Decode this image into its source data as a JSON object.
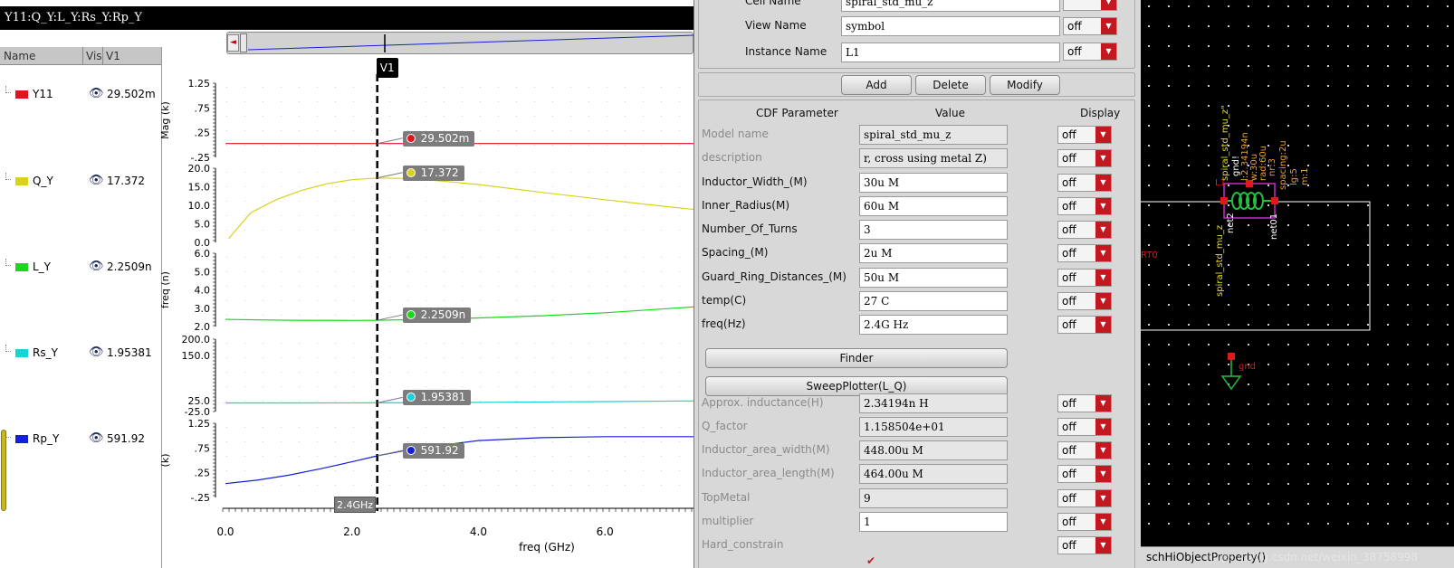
{
  "viewer": {
    "title": "Y11:Q_Y:L_Y:Rs_Y:Rp_Y",
    "columns": {
      "name": "Name",
      "vis": "Vis",
      "v1": "V1"
    },
    "signals": [
      {
        "name": "Y11",
        "value": "29.502m",
        "color": "#e0141c"
      },
      {
        "name": "Q_Y",
        "value": "17.372",
        "color": "#d8d21c"
      },
      {
        "name": "L_Y",
        "value": "2.2509n",
        "color": "#1cd81c"
      },
      {
        "name": "Rs_Y",
        "value": "1.95381",
        "color": "#1cd2d8"
      },
      {
        "name": "Rp_Y",
        "value": "591.92",
        "color": "#1420d8"
      }
    ],
    "eye_glyph": "👁",
    "vertical_marker": "V1",
    "cursor_x_label": "2.4GHz"
  },
  "chart_data": {
    "type": "line",
    "xlabel": "freq (GHz)",
    "x_ticks": [
      "0.0",
      "2.0",
      "4.0",
      "6.0"
    ],
    "xlim": [
      0,
      7.4
    ],
    "marker_x": 2.4,
    "strips": [
      {
        "name": "Y11",
        "ylabel": "Mag (k)",
        "yticks": [
          "1.25",
          ".75",
          ".25",
          "-.25"
        ],
        "ylim": [
          -0.25,
          1.25
        ],
        "series": {
          "name": "Y11",
          "x": [
            0,
            7.4
          ],
          "y": [
            0.0295,
            0.0295
          ]
        },
        "marker": {
          "x": 2.4,
          "label": "29.502m"
        }
      },
      {
        "name": "Q_Y",
        "ylabel": "",
        "yticks": [
          "20.0",
          "15.0",
          "10.0",
          "5.0",
          "0.0"
        ],
        "ylim": [
          0,
          20
        ],
        "series": {
          "name": "Q_Y",
          "x": [
            0.05,
            0.4,
            0.8,
            1.2,
            1.6,
            2.0,
            2.4,
            3.0,
            4.0,
            5.0,
            6.0,
            7.0,
            7.4
          ],
          "y": [
            1.0,
            8.0,
            11.5,
            14.0,
            15.8,
            16.9,
            17.372,
            17.2,
            15.6,
            13.5,
            11.5,
            9.6,
            8.9
          ]
        },
        "marker": {
          "x": 2.4,
          "label": "17.372"
        }
      },
      {
        "name": "L_Y",
        "ylabel": "freq (n)",
        "yticks": [
          "6.0",
          "5.0",
          "4.0",
          "3.0",
          "2.0"
        ],
        "ylim": [
          1.9,
          6.0
        ],
        "series": {
          "name": "L_Y",
          "x": [
            0,
            1.0,
            2.0,
            2.4,
            3.0,
            4.0,
            5.0,
            6.0,
            7.0,
            7.4
          ],
          "y": [
            2.3,
            2.25,
            2.24,
            2.2509,
            2.29,
            2.38,
            2.5,
            2.67,
            2.9,
            3.0
          ]
        },
        "marker": {
          "x": 2.4,
          "label": "2.2509n"
        }
      },
      {
        "name": "Rs_Y",
        "ylabel": "",
        "yticks": [
          "200.0",
          "150.0",
          "25.0",
          "-25.0"
        ],
        "ylim": [
          -25,
          200
        ],
        "series": {
          "name": "Rs_Y",
          "x": [
            0,
            1.0,
            2.4,
            4.0,
            6.0,
            7.4
          ],
          "y": [
            1.8,
            1.85,
            1.95381,
            3.5,
            6.0,
            8.0
          ]
        },
        "marker": {
          "x": 2.4,
          "label": "1.95381"
        }
      },
      {
        "name": "Rp_Y",
        "ylabel": "(k)",
        "yticks": [
          "1.25",
          ".75",
          ".25",
          "-.25"
        ],
        "ylim": [
          -0.25,
          1.25
        ],
        "series": {
          "name": "Rp_Y",
          "x": [
            0,
            0.5,
            1.0,
            1.5,
            2.0,
            2.4,
            3.0,
            4.0,
            5.0,
            6.0,
            7.0,
            7.4
          ],
          "y": [
            0.03,
            0.1,
            0.2,
            0.33,
            0.47,
            0.592,
            0.74,
            0.9,
            0.96,
            0.98,
            0.98,
            0.98
          ]
        },
        "marker": {
          "x": 2.4,
          "label": "591.92"
        }
      }
    ]
  },
  "dialog": {
    "top_fields": [
      {
        "label": "Cell Name",
        "value": "spiral_std_mu_z",
        "display": ""
      },
      {
        "label": "View Name",
        "value": "symbol",
        "display": "off"
      },
      {
        "label": "Instance Name",
        "value": "L1",
        "display": "off"
      }
    ],
    "buttons": {
      "add": "Add",
      "delete": "Delete",
      "modify": "Modify"
    },
    "headers": {
      "param": "CDF Parameter",
      "value": "Value",
      "display": "Display"
    },
    "params": [
      {
        "label": "Model name",
        "value": "spiral_std_mu_z",
        "display": "off",
        "readonly": true
      },
      {
        "label": "description",
        "value": "r, cross using metal Z)",
        "display": "off",
        "readonly": true
      },
      {
        "label": "Inductor_Width_(M)",
        "value": "30u M",
        "display": "off",
        "readonly": false
      },
      {
        "label": "Inner_Radius(M)",
        "value": "60u M",
        "display": "off",
        "readonly": false
      },
      {
        "label": "Number_Of_Turns",
        "value": "3",
        "display": "off",
        "readonly": false
      },
      {
        "label": "Spacing_(M)",
        "value": "2u M",
        "display": "off",
        "readonly": false
      },
      {
        "label": "Guard_Ring_Distances_(M)",
        "value": "50u M",
        "display": "off",
        "readonly": false
      },
      {
        "label": "temp(C)",
        "value": "27 C",
        "display": "off",
        "readonly": false
      },
      {
        "label": "freq(Hz)",
        "value": "2.4G Hz",
        "display": "off",
        "readonly": false
      }
    ],
    "finder_label": "Finder",
    "sweep_label": "SweepPlotter(L_Q)",
    "results": [
      {
        "label": "Approx. inductance(H)",
        "value": "2.34194n H",
        "display": "off"
      },
      {
        "label": "Q_factor",
        "value": "1.158504e+01",
        "display": "off"
      },
      {
        "label": "Inductor_area_width(M)",
        "value": "448.00u M",
        "display": "off"
      },
      {
        "label": "Inductor_area_length(M)",
        "value": "464.00u M",
        "display": "off"
      },
      {
        "label": "TopMetal",
        "value": "9",
        "display": "off"
      },
      {
        "label": "multiplier",
        "value": "1",
        "display": "off"
      },
      {
        "label": "Hard_constrain",
        "value": "",
        "display": "off"
      }
    ],
    "check_mark": "✔",
    "dropdown_arrow": "▼"
  },
  "schematic": {
    "instance_name": "L1",
    "cell_label": "spiral_std_mu_z",
    "net_left": "net2",
    "net_right": "net01",
    "rt_label": "RT0",
    "gnd_label": "gnd",
    "vertical_props": [
      "spiral_std_mu_z\"",
      "gnd!",
      "l:2.34194n",
      "w:30u",
      "rad:60u",
      "nr:3",
      "spacing:2u",
      "lg:5",
      "m:1"
    ],
    "colors": {
      "background": "#000000",
      "wire": "#ffffff",
      "pin": "#e01818",
      "label": "#e8e020",
      "prop": "#f0a020",
      "body": "#20c040",
      "box": "#c030c0"
    },
    "status": "schHiObjectProperty()",
    "watermark": "https://blog.csdn.net/weixin_38758998"
  }
}
